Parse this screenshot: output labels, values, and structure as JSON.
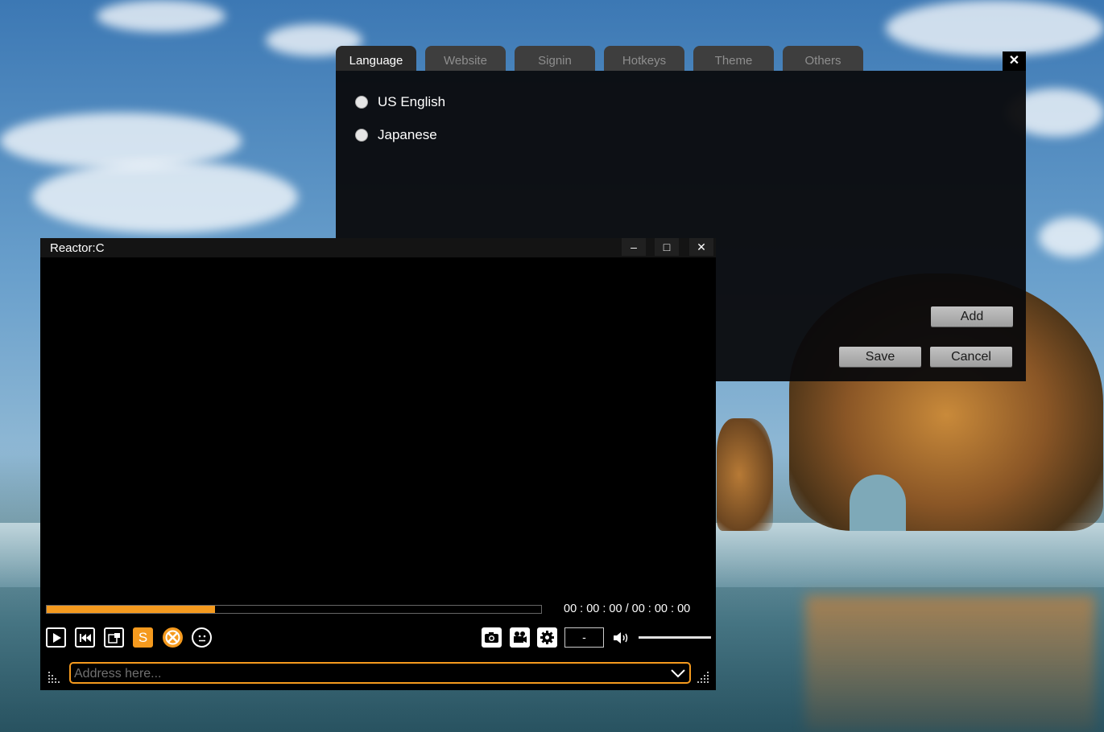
{
  "settings": {
    "tabs": [
      {
        "label": "Language"
      },
      {
        "label": "Website"
      },
      {
        "label": "Signin"
      },
      {
        "label": "Hotkeys"
      },
      {
        "label": "Theme"
      },
      {
        "label": "Others"
      }
    ],
    "close_label": "✕",
    "languages": [
      {
        "label": "US English"
      },
      {
        "label": "Japanese"
      }
    ],
    "add_label": "Add",
    "save_label": "Save",
    "cancel_label": "Cancel"
  },
  "player": {
    "title": "Reactor:C",
    "minimize_label": "–",
    "maximize_label": "□",
    "close_label": "✕",
    "progress_fraction": 0.34,
    "time_display": "00 : 00 : 00 / 00 : 00 : 00",
    "s_button_label": "S",
    "speed_value": "-",
    "address_placeholder": "Address here..."
  },
  "colors": {
    "accent": "#f59a1e",
    "dialog_bg": "#0a0a0c",
    "tab_bg": "#3e3e3e"
  }
}
